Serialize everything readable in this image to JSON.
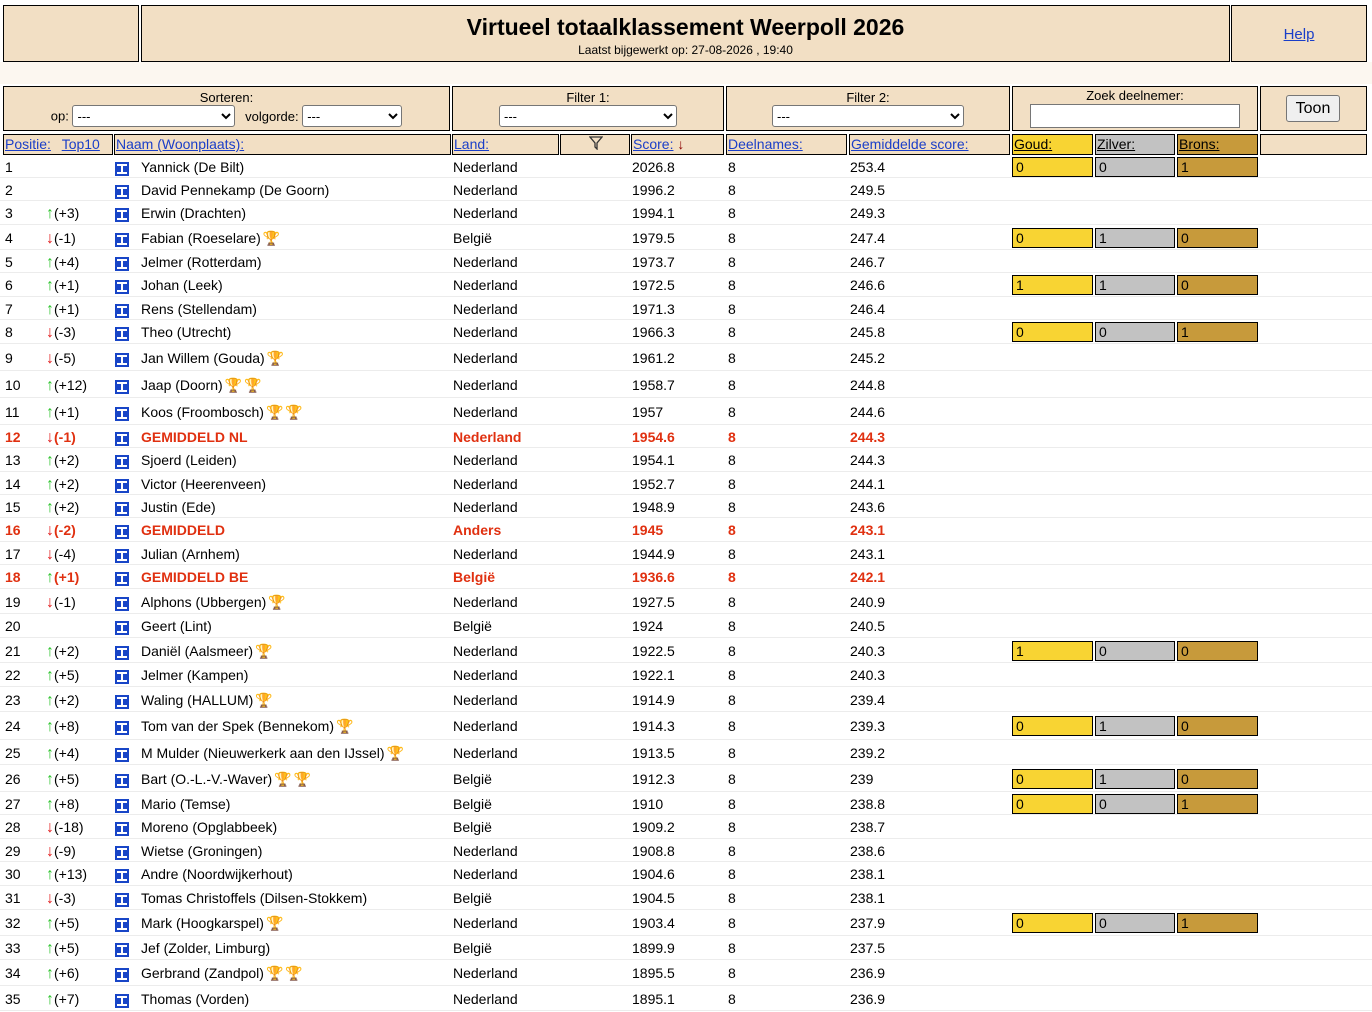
{
  "header": {
    "title": "Virtueel totaalklassement Weerpoll 2026",
    "subtitle": "Laatst bijgewerkt op: 27-08-2026 , 19:40",
    "help": "Help"
  },
  "controls": {
    "sort_label": "Sorteren:",
    "sort_op_label": "op:",
    "sort_op_value": "---",
    "sort_order_label": "volgorde:",
    "sort_order_value": "---",
    "filter1_label": "Filter 1:",
    "filter1_value": "---",
    "filter2_label": "Filter 2:",
    "filter2_value": "---",
    "search_label": "Zoek deelnemer:",
    "search_value": "",
    "show_button": "Toon"
  },
  "columns": {
    "positie": "Positie:",
    "top10": "Top10",
    "naam": "Naam (Woonplaats):",
    "land": "Land:",
    "score": "Score:",
    "deelnames": "Deelnames:",
    "gemiddelde": "Gemiddelde score:",
    "goud": "Goud:",
    "zilver": "Zilver:",
    "brons": "Brons:"
  },
  "rows": [
    {
      "pos": "1",
      "dir": "",
      "delta": "",
      "name": "Yannick (De Bilt)",
      "trophies": [],
      "land": "Nederland",
      "score": "2026.8",
      "dn": "8",
      "gem": "253.4",
      "medals": [
        "0",
        "0",
        "1"
      ]
    },
    {
      "pos": "2",
      "dir": "",
      "delta": "",
      "name": "David Pennekamp (De Goorn)",
      "trophies": [],
      "land": "Nederland",
      "score": "1996.2",
      "dn": "8",
      "gem": "249.5",
      "medals": null
    },
    {
      "pos": "3",
      "dir": "up",
      "delta": "(+3)",
      "name": "Erwin (Drachten)",
      "trophies": [],
      "land": "Nederland",
      "score": "1994.1",
      "dn": "8",
      "gem": "249.3",
      "medals": null
    },
    {
      "pos": "4",
      "dir": "down",
      "delta": "(-1)",
      "name": "Fabian (Roeselare)",
      "trophies": [
        "g"
      ],
      "land": "België",
      "score": "1979.5",
      "dn": "8",
      "gem": "247.4",
      "medals": [
        "0",
        "1",
        "0"
      ]
    },
    {
      "pos": "5",
      "dir": "up",
      "delta": "(+4)",
      "name": "Jelmer (Rotterdam)",
      "trophies": [],
      "land": "Nederland",
      "score": "1973.7",
      "dn": "8",
      "gem": "246.7",
      "medals": null
    },
    {
      "pos": "6",
      "dir": "up",
      "delta": "(+1)",
      "name": "Johan (Leek)",
      "trophies": [],
      "land": "Nederland",
      "score": "1972.5",
      "dn": "8",
      "gem": "246.6",
      "medals": [
        "1",
        "1",
        "0"
      ]
    },
    {
      "pos": "7",
      "dir": "up",
      "delta": "(+1)",
      "name": "Rens (Stellendam)",
      "trophies": [],
      "land": "Nederland",
      "score": "1971.3",
      "dn": "8",
      "gem": "246.4",
      "medals": null
    },
    {
      "pos": "8",
      "dir": "down",
      "delta": "(-3)",
      "name": "Theo (Utrecht)",
      "trophies": [],
      "land": "Nederland",
      "score": "1966.3",
      "dn": "8",
      "gem": "245.8",
      "medals": [
        "0",
        "0",
        "1"
      ]
    },
    {
      "pos": "9",
      "dir": "down",
      "delta": "(-5)",
      "name": "Jan Willem (Gouda)",
      "trophies": [
        "g"
      ],
      "land": "Nederland",
      "score": "1961.2",
      "dn": "8",
      "gem": "245.2",
      "medals": null
    },
    {
      "pos": "10",
      "dir": "up",
      "delta": "(+12)",
      "name": "Jaap (Doorn)",
      "trophies": [
        "s",
        "s"
      ],
      "land": "Nederland",
      "score": "1958.7",
      "dn": "8",
      "gem": "244.8",
      "medals": null
    },
    {
      "pos": "11",
      "dir": "up",
      "delta": "(+1)",
      "name": "Koos (Froombosch)",
      "trophies": [
        "g",
        "g"
      ],
      "land": "Nederland",
      "score": "1957",
      "dn": "8",
      "gem": "244.6",
      "medals": null
    },
    {
      "pos": "12",
      "dir": "down",
      "delta": "(-1)",
      "name": "GEMIDDELD NL",
      "trophies": [],
      "land": "Nederland",
      "score": "1954.6",
      "dn": "8",
      "gem": "244.3",
      "medals": null,
      "red": true
    },
    {
      "pos": "13",
      "dir": "up",
      "delta": "(+2)",
      "name": "Sjoerd (Leiden)",
      "trophies": [],
      "land": "Nederland",
      "score": "1954.1",
      "dn": "8",
      "gem": "244.3",
      "medals": null
    },
    {
      "pos": "14",
      "dir": "up",
      "delta": "(+2)",
      "name": "Victor (Heerenveen)",
      "trophies": [],
      "land": "Nederland",
      "score": "1952.7",
      "dn": "8",
      "gem": "244.1",
      "medals": null
    },
    {
      "pos": "15",
      "dir": "up",
      "delta": "(+2)",
      "name": "Justin (Ede)",
      "trophies": [],
      "land": "Nederland",
      "score": "1948.9",
      "dn": "8",
      "gem": "243.6",
      "medals": null
    },
    {
      "pos": "16",
      "dir": "down",
      "delta": "(-2)",
      "name": "GEMIDDELD",
      "trophies": [],
      "land": "Anders",
      "score": "1945",
      "dn": "8",
      "gem": "243.1",
      "medals": null,
      "red": true
    },
    {
      "pos": "17",
      "dir": "down",
      "delta": "(-4)",
      "name": "Julian (Arnhem)",
      "trophies": [],
      "land": "Nederland",
      "score": "1944.9",
      "dn": "8",
      "gem": "243.1",
      "medals": null
    },
    {
      "pos": "18",
      "dir": "up",
      "delta": "(+1)",
      "name": "GEMIDDELD BE",
      "trophies": [],
      "land": "België",
      "score": "1936.6",
      "dn": "8",
      "gem": "242.1",
      "medals": null,
      "red": true
    },
    {
      "pos": "19",
      "dir": "down",
      "delta": "(-1)",
      "name": "Alphons (Ubbergen)",
      "trophies": [
        "b"
      ],
      "land": "Nederland",
      "score": "1927.5",
      "dn": "8",
      "gem": "240.9",
      "medals": null
    },
    {
      "pos": "20",
      "dir": "",
      "delta": "",
      "name": "Geert (Lint)",
      "trophies": [],
      "land": "België",
      "score": "1924",
      "dn": "8",
      "gem": "240.5",
      "medals": null
    },
    {
      "pos": "21",
      "dir": "up",
      "delta": "(+2)",
      "name": "Daniël (Aalsmeer)",
      "trophies": [
        "b"
      ],
      "land": "Nederland",
      "score": "1922.5",
      "dn": "8",
      "gem": "240.3",
      "medals": [
        "1",
        "0",
        "0"
      ]
    },
    {
      "pos": "22",
      "dir": "up",
      "delta": "(+5)",
      "name": "Jelmer (Kampen)",
      "trophies": [],
      "land": "Nederland",
      "score": "1922.1",
      "dn": "8",
      "gem": "240.3",
      "medals": null
    },
    {
      "pos": "23",
      "dir": "up",
      "delta": "(+2)",
      "name": "Waling (HALLUM)",
      "trophies": [
        "b"
      ],
      "land": "Nederland",
      "score": "1914.9",
      "dn": "8",
      "gem": "239.4",
      "medals": null
    },
    {
      "pos": "24",
      "dir": "up",
      "delta": "(+8)",
      "name": "Tom van der Spek (Bennekom)",
      "trophies": [
        "g"
      ],
      "land": "Nederland",
      "score": "1914.3",
      "dn": "8",
      "gem": "239.3",
      "medals": [
        "0",
        "1",
        "0"
      ]
    },
    {
      "pos": "25",
      "dir": "up",
      "delta": "(+4)",
      "name": "M Mulder (Nieuwerkerk aan den IJssel)",
      "trophies": [
        "g"
      ],
      "land": "Nederland",
      "score": "1913.5",
      "dn": "8",
      "gem": "239.2",
      "medals": null
    },
    {
      "pos": "26",
      "dir": "up",
      "delta": "(+5)",
      "name": "Bart (O.-L.-V.-Waver)",
      "trophies": [
        "g",
        "g"
      ],
      "land": "België",
      "score": "1912.3",
      "dn": "8",
      "gem": "239",
      "medals": [
        "0",
        "1",
        "0"
      ]
    },
    {
      "pos": "27",
      "dir": "up",
      "delta": "(+8)",
      "name": "Mario (Temse)",
      "trophies": [],
      "land": "België",
      "score": "1910",
      "dn": "8",
      "gem": "238.8",
      "medals": [
        "0",
        "0",
        "1"
      ]
    },
    {
      "pos": "28",
      "dir": "down",
      "delta": "(-18)",
      "name": "Moreno (Opglabbeek)",
      "trophies": [],
      "land": "België",
      "score": "1909.2",
      "dn": "8",
      "gem": "238.7",
      "medals": null
    },
    {
      "pos": "29",
      "dir": "down",
      "delta": "(-9)",
      "name": "Wietse (Groningen)",
      "trophies": [],
      "land": "Nederland",
      "score": "1908.8",
      "dn": "8",
      "gem": "238.6",
      "medals": null
    },
    {
      "pos": "30",
      "dir": "up",
      "delta": "(+13)",
      "name": "Andre (Noordwijkerhout)",
      "trophies": [],
      "land": "Nederland",
      "score": "1904.6",
      "dn": "8",
      "gem": "238.1",
      "medals": null
    },
    {
      "pos": "31",
      "dir": "down",
      "delta": "(-3)",
      "name": "Tomas Christoffels (Dilsen-Stokkem)",
      "trophies": [],
      "land": "België",
      "score": "1904.5",
      "dn": "8",
      "gem": "238.1",
      "medals": null
    },
    {
      "pos": "32",
      "dir": "up",
      "delta": "(+5)",
      "name": "Mark (Hoogkarspel)",
      "trophies": [
        "s"
      ],
      "land": "Nederland",
      "score": "1903.4",
      "dn": "8",
      "gem": "237.9",
      "medals": [
        "0",
        "0",
        "1"
      ]
    },
    {
      "pos": "33",
      "dir": "up",
      "delta": "(+5)",
      "name": "Jef (Zolder, Limburg)",
      "trophies": [],
      "land": "België",
      "score": "1899.9",
      "dn": "8",
      "gem": "237.5",
      "medals": null
    },
    {
      "pos": "34",
      "dir": "up",
      "delta": "(+6)",
      "name": "Gerbrand (Zandpol)",
      "trophies": [
        "b",
        "b"
      ],
      "land": "Nederland",
      "score": "1895.5",
      "dn": "8",
      "gem": "236.9",
      "medals": null
    },
    {
      "pos": "35",
      "dir": "up",
      "delta": "(+7)",
      "name": "Thomas (Vorden)",
      "trophies": [],
      "land": "Nederland",
      "score": "1895.1",
      "dn": "8",
      "gem": "236.9",
      "medals": null
    }
  ]
}
